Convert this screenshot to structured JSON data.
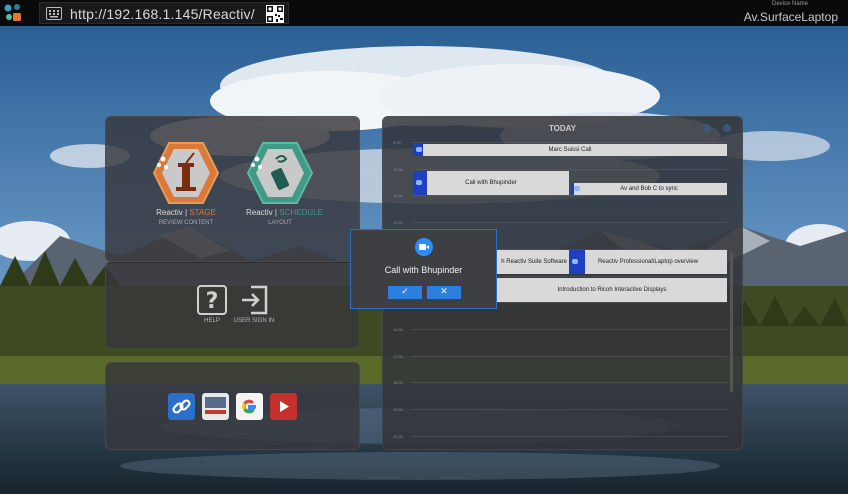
{
  "topbar": {
    "url": "http://192.168.1.145/Reactiv/",
    "device_label": "Device Name",
    "device_name": "Av.SurfaceLaptop"
  },
  "tiles": {
    "stage": {
      "brand": "Reactiv",
      "product": "STAGE",
      "caption": "REVIEW CONTENT"
    },
    "schedule": {
      "brand": "Reactiv",
      "product": "SCHEDULE",
      "caption": "LAYOUT"
    },
    "help": {
      "caption": "HELP"
    },
    "signin": {
      "caption": "USER SIGN IN"
    }
  },
  "links": [
    "link-icon",
    "vizeto-icon",
    "google-icon",
    "youtube-icon"
  ],
  "calendar": {
    "title": "TODAY",
    "times": [
      "9:00",
      "10:00",
      "11:00",
      "12:00",
      "13:00",
      "14:00",
      "15:00",
      "16:00",
      "17:00",
      "18:00",
      "19:00",
      "20:00",
      "21:00",
      "22:00"
    ],
    "events": [
      {
        "label": "Marc Suissi Call"
      },
      {
        "label": "Call with Bhupinder"
      },
      {
        "label": "Av and Bob C to sync"
      },
      {
        "label": "h Reactiv Suite Software"
      },
      {
        "label": "Reactiv Professional\\Laptop overview"
      },
      {
        "label": "Introduction to Ricoh Interactive Displays"
      }
    ]
  },
  "modal": {
    "title": "Call with Bhupinder",
    "accept_label": "✓",
    "dismiss_label": "✕"
  },
  "colors": {
    "accent": "#2d7fe0",
    "stage_orange": "#d97a3a",
    "schedule_teal": "#3f9a86",
    "zoom_blue": "#2d8cff"
  }
}
